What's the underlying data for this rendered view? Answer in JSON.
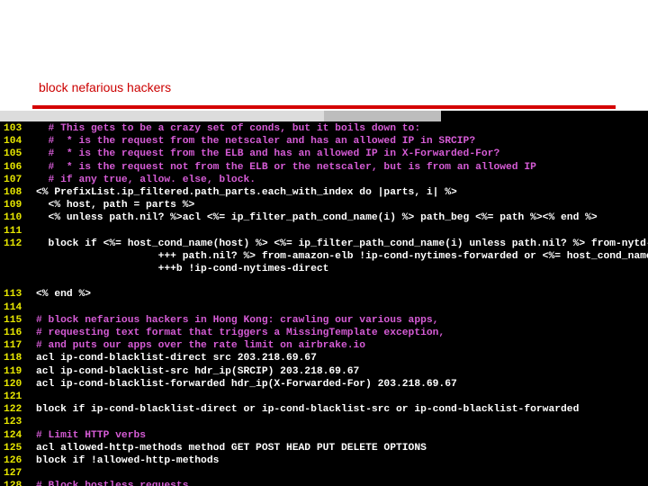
{
  "slide": {
    "title": "block nefarious hackers"
  },
  "editor": {
    "lines": [
      {
        "n": "103",
        "t": "  # This gets to be a crazy set of conds, but it boils down to:",
        "k": "comment"
      },
      {
        "n": "104",
        "t": "  #  * is the request from the netscaler and has an allowed IP in SRCIP?",
        "k": "comment"
      },
      {
        "n": "105",
        "t": "  #  * is the request from the ELB and has an allowed IP in X-Forwarded-For?",
        "k": "comment"
      },
      {
        "n": "106",
        "t": "  #  * is the request not from the ELB or the netscaler, but is from an allowed IP",
        "k": "comment"
      },
      {
        "n": "107",
        "t": "  # if any true, allow. else, block.",
        "k": "comment"
      },
      {
        "n": "108",
        "t": "<% PrefixList.ip_filtered.path_parts.each_with_index do |parts, i| %>",
        "k": "erb"
      },
      {
        "n": "109",
        "t": "  <% host, path = parts %>",
        "k": "erb"
      },
      {
        "n": "110",
        "t": "  <% unless path.nil? %>acl <%= ip_filter_path_cond_name(i) %> path_beg <%= path %><% end %>",
        "k": "erb"
      },
      {
        "n": "111",
        "t": "",
        "k": "plain"
      },
      {
        "n": "112",
        "t": "  block if <%= host_cond_name(host) %> <%= ip_filter_path_cond_name(i) unless path.nil? %> from-nytd-prod !ip",
        "k": "plain"
      },
      {
        "n": "",
        "t": "                    +++ path.nil? %> from-amazon-elb !ip-cond-nytimes-forwarded or <%= host_cond_name(host)",
        "k": "plain"
      },
      {
        "n": "",
        "t": "                    +++b !ip-cond-nytimes-direct",
        "k": "plain"
      },
      {
        "n": "",
        "t": "",
        "k": "plain"
      },
      {
        "n": "113",
        "t": "<% end %>",
        "k": "erb"
      },
      {
        "n": "114",
        "t": "",
        "k": "plain"
      },
      {
        "n": "115",
        "t": "# block nefarious hackers in Hong Kong: crawling our various apps,",
        "k": "comment"
      },
      {
        "n": "116",
        "t": "# requesting text format that triggers a MissingTemplate exception,",
        "k": "comment"
      },
      {
        "n": "117",
        "t": "# and puts our apps over the rate limit on airbrake.io",
        "k": "comment"
      },
      {
        "n": "118",
        "t": "acl ip-cond-blacklist-direct src 203.218.69.67",
        "k": "plain"
      },
      {
        "n": "119",
        "t": "acl ip-cond-blacklist-src hdr_ip(SRCIP) 203.218.69.67",
        "k": "plain"
      },
      {
        "n": "120",
        "t": "acl ip-cond-blacklist-forwarded hdr_ip(X-Forwarded-For) 203.218.69.67",
        "k": "plain"
      },
      {
        "n": "121",
        "t": "",
        "k": "plain"
      },
      {
        "n": "122",
        "t": "block if ip-cond-blacklist-direct or ip-cond-blacklist-src or ip-cond-blacklist-forwarded",
        "k": "plain"
      },
      {
        "n": "123",
        "t": "",
        "k": "plain"
      },
      {
        "n": "124",
        "t": "# Limit HTTP verbs",
        "k": "comment"
      },
      {
        "n": "125",
        "t": "acl allowed-http-methods method GET POST HEAD PUT DELETE OPTIONS",
        "k": "plain"
      },
      {
        "n": "126",
        "t": "block if !allowed-http-methods",
        "k": "plain"
      },
      {
        "n": "127",
        "t": "",
        "k": "plain"
      },
      {
        "n": "128",
        "t": "# Block hostless requests",
        "k": "comment"
      }
    ]
  },
  "colors": {
    "title": "#cc0000",
    "rule": "#d40000",
    "line_numbers": "#e6e600",
    "comment": "#d65cd6",
    "code_text": "#ffffff",
    "terminal_bg": "#000000"
  }
}
